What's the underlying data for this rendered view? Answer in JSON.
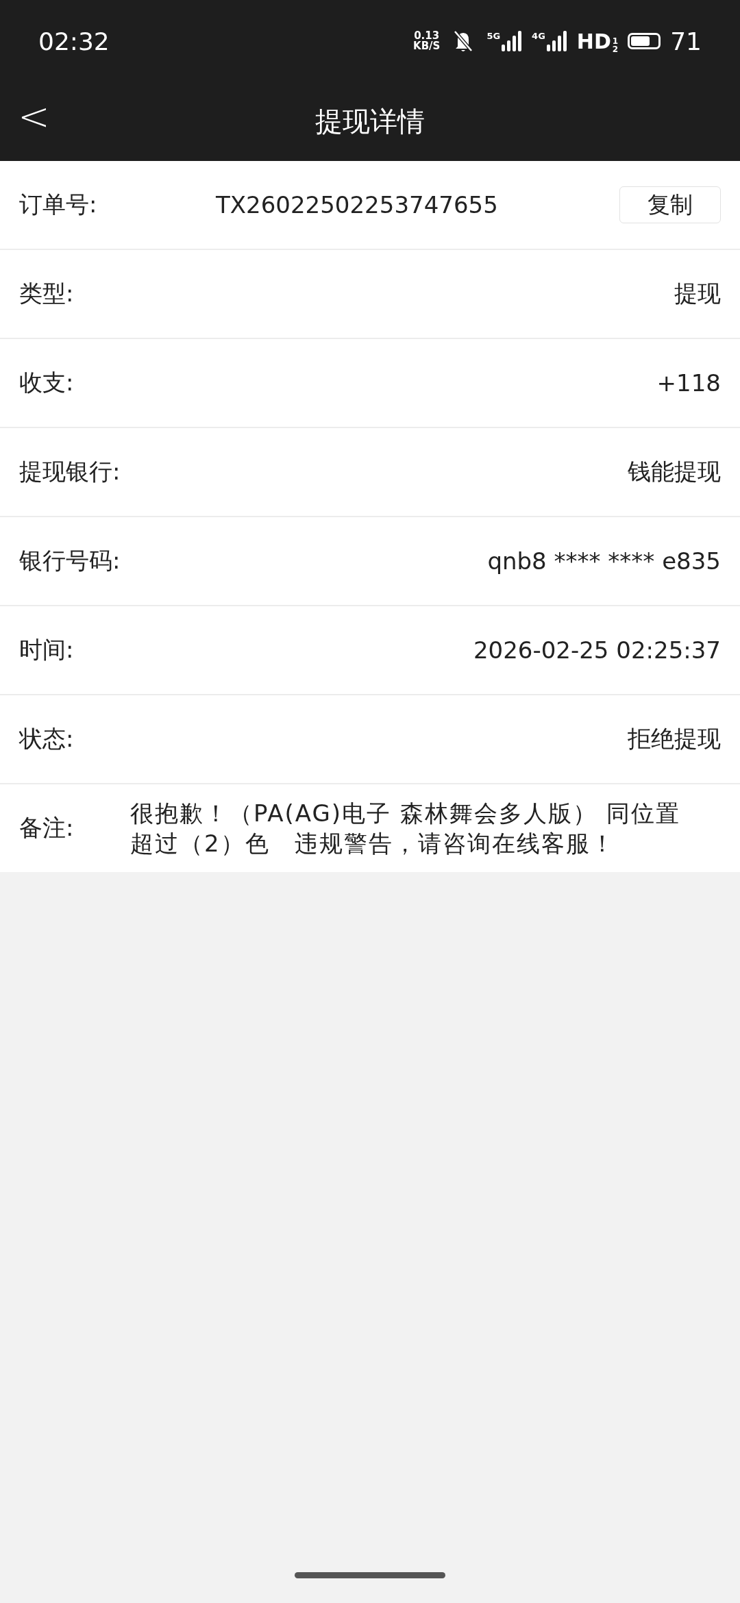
{
  "status_bar": {
    "time": "02:32",
    "net_speed": "0.13",
    "net_unit": "KB/S",
    "networks": [
      "5G",
      "4G"
    ],
    "hd": "HD",
    "hd_marks": [
      "1",
      "2"
    ],
    "battery": "71"
  },
  "header": {
    "back": "<",
    "title": "提现详情"
  },
  "order": {
    "label": "订单号:",
    "value": "TX26022502253747655",
    "copy": "复制"
  },
  "rows": [
    {
      "label": "类型:",
      "value": "提现"
    },
    {
      "label": "收支:",
      "value": "+118"
    },
    {
      "label": "提现银行:",
      "value": "钱能提现"
    },
    {
      "label": "银行号码:",
      "value": "qnb8 **** **** e835"
    },
    {
      "label": "时间:",
      "value": "2026-02-25 02:25:37"
    },
    {
      "label": "状态:",
      "value": "拒绝提现"
    }
  ],
  "remark": {
    "label": "备注:",
    "text": "很抱歉！（PA(AG)电子 森林舞会多人版） 同位置超过（2）色　违规警告，请咨询在线客服！"
  }
}
